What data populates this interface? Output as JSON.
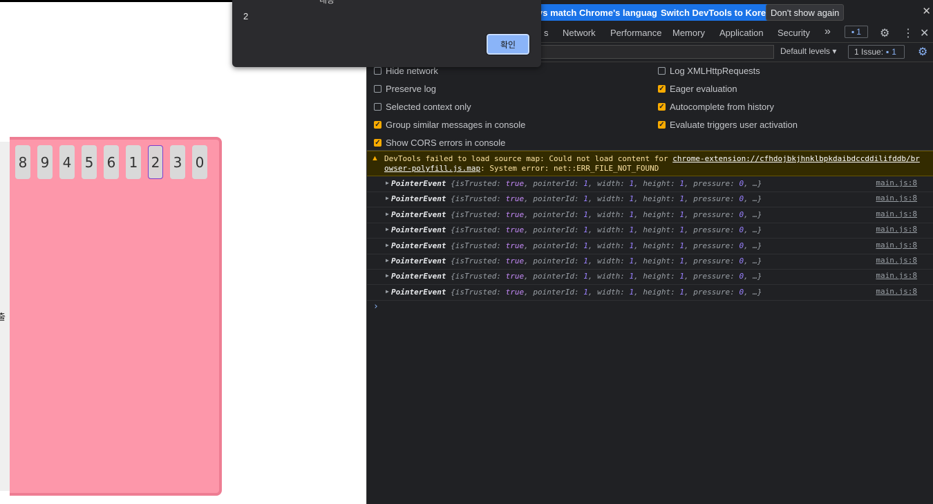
{
  "page": {
    "side_label": "출",
    "numbers": [
      "8",
      "9",
      "4",
      "5",
      "6",
      "1",
      "2",
      "3",
      "0"
    ],
    "selected_index": 6
  },
  "alert": {
    "top_fragment": "내용",
    "message": "2",
    "ok_label": "확인"
  },
  "devtools": {
    "infobar": {
      "match_language": "ys match Chrome's language",
      "switch_korean": "Switch DevTools to Korean",
      "dont_show": "Don't show again"
    },
    "tabs": {
      "sources_fragment": "s",
      "network": "Network",
      "performance": "Performance",
      "memory": "Memory",
      "application": "Application",
      "security": "Security",
      "more": "»",
      "issue_count": "1"
    },
    "filter": {
      "levels": "Default levels",
      "issues_label": "1 Issue:",
      "issues_count": "1"
    },
    "settings": {
      "hide_network": "Hide network",
      "preserve_log": "Preserve log",
      "selected_context": "Selected context only",
      "group_similar": "Group similar messages in console",
      "show_cors": "Show CORS errors in console",
      "log_xhr": "Log XMLHttpRequests",
      "eager_eval": "Eager evaluation",
      "autocomplete": "Autocomplete from history",
      "evaluate_triggers": "Evaluate triggers user activation"
    },
    "warning": {
      "prefix": "DevTools failed to load source map: Could not load content for ",
      "link": "chrome-extension://cfhdojbkjhnklbpkdaibdccddilifddb/browser-polyfill.js.map",
      "suffix": ": System error: net::ERR_FILE_NOT_FOUND"
    },
    "log": {
      "class_name": "PointerEvent",
      "source": "main.js:8",
      "rows": 8
    }
  }
}
